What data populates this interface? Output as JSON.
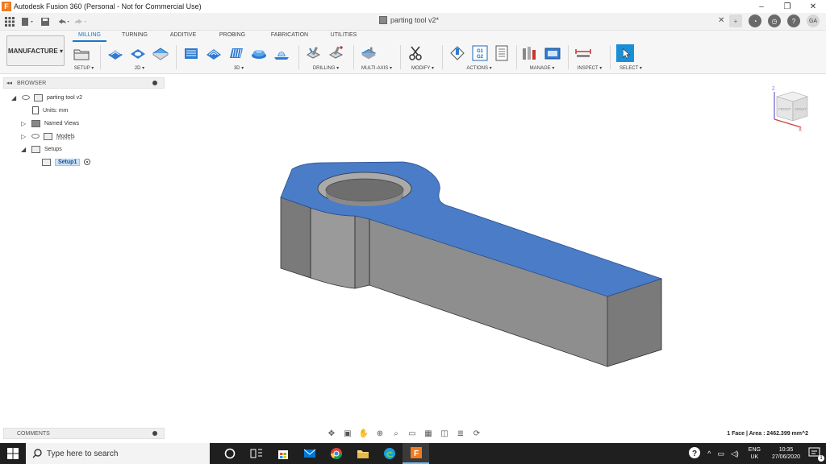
{
  "window": {
    "title": "Autodesk Fusion 360 (Personal - Not for Commercial Use)",
    "logo_letter": "F",
    "minimize": "–",
    "restore": "❐",
    "close": "✕"
  },
  "document": {
    "tab_title": "parting tool v2*",
    "close": "✕"
  },
  "user": {
    "initials": "GA"
  },
  "toolbar": {
    "workspace": "MANUFACTURE ▾",
    "tabs": [
      "MILLING",
      "TURNING",
      "ADDITIVE",
      "PROBING",
      "FABRICATION",
      "UTILITIES"
    ],
    "active_tab": "MILLING",
    "groups": {
      "setup": "SETUP ▾",
      "two_d": "2D ▾",
      "three_d": "3D ▾",
      "drilling": "DRILLING ▾",
      "multi_axis": "MULTI-AXIS ▾",
      "modify": "MODIFY ▾",
      "actions": "ACTIONS ▾",
      "manage": "MANAGE ▾",
      "inspect": "INSPECT ▾",
      "select": "SELECT ▾"
    },
    "g_code_label": "G1\nG2"
  },
  "browser": {
    "title": "BROWSER",
    "root": "parting tool v2",
    "units": "Units: mm",
    "named_views": "Named Views",
    "models": "Models",
    "setups": "Setups",
    "setup1": "Setup1"
  },
  "viewcube": {
    "front": "FRONT",
    "right": "RIGHT",
    "z": "Z",
    "x": "X"
  },
  "comments": {
    "title": "COMMENTS"
  },
  "status": {
    "selection": "1 Face | Area : 2462.399 mm^2"
  },
  "taskbar": {
    "search_placeholder": "Type here to search",
    "lang_line1": "ENG",
    "lang_line2": "UK",
    "time": "10:35",
    "date": "27/06/2020",
    "notification_count": "1"
  },
  "colors": {
    "accent": "#1b77c7",
    "model_top": "#4a7cc7",
    "model_side": "#8c8c8c",
    "fusion_orange": "#f27b1f"
  }
}
